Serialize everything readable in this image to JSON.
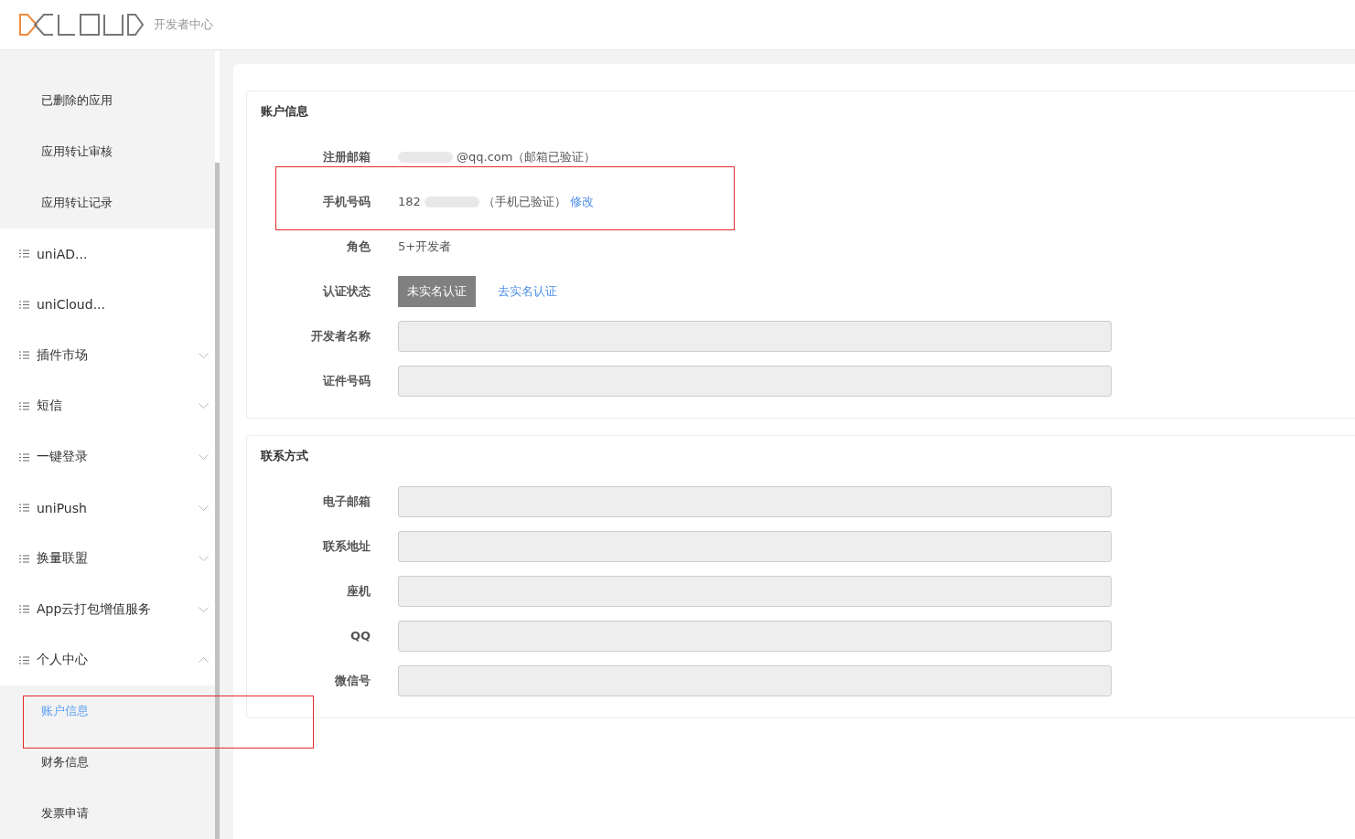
{
  "header": {
    "subtitle": "开发者中心"
  },
  "sidebar": {
    "items": [
      {
        "kind": "sub",
        "label": "已删除的应用",
        "selected": false
      },
      {
        "kind": "sub",
        "label": "应用转让审核",
        "selected": false
      },
      {
        "kind": "sub",
        "label": "应用转让记录",
        "selected": false
      },
      {
        "kind": "menu",
        "label": "uniAD..."
      },
      {
        "kind": "menu",
        "label": "uniCloud..."
      },
      {
        "kind": "menu",
        "label": "插件市场",
        "expanded": false
      },
      {
        "kind": "menu",
        "label": "短信",
        "expanded": false
      },
      {
        "kind": "menu",
        "label": "一键登录",
        "expanded": false
      },
      {
        "kind": "menu",
        "label": "uniPush",
        "expanded": false
      },
      {
        "kind": "menu",
        "label": "换量联盟",
        "expanded": false
      },
      {
        "kind": "menu",
        "label": "App云打包增值服务",
        "expanded": false
      },
      {
        "kind": "menu",
        "label": "个人中心",
        "expanded": true
      },
      {
        "kind": "sub",
        "label": "账户信息",
        "selected": true
      },
      {
        "kind": "sub",
        "label": "财务信息",
        "selected": false
      },
      {
        "kind": "sub",
        "label": "发票申请",
        "selected": false
      }
    ]
  },
  "account": {
    "title": "账户信息",
    "rows": [
      {
        "kind": "text",
        "label": "注册邮箱",
        "blurred": true,
        "value": "@qq.com（邮箱已验证）"
      },
      {
        "kind": "text",
        "label": "手机号码",
        "value": "182",
        "blurred": true,
        "value2": "（手机已验证）",
        "link": "修改"
      },
      {
        "kind": "text",
        "label": "角色",
        "value": "5+开发者"
      },
      {
        "kind": "status",
        "label": "认证状态",
        "badge": "未实名认证",
        "link": "去实名认证"
      },
      {
        "kind": "input",
        "label": "开发者名称"
      },
      {
        "kind": "input",
        "label": "证件号码"
      }
    ]
  },
  "contact": {
    "title": "联系方式",
    "rows": [
      {
        "kind": "input",
        "label": "电子邮箱"
      },
      {
        "kind": "input",
        "label": "联系地址"
      },
      {
        "kind": "input",
        "label": "座机"
      },
      {
        "kind": "input",
        "label": "QQ"
      },
      {
        "kind": "input",
        "label": "微信号"
      }
    ]
  }
}
